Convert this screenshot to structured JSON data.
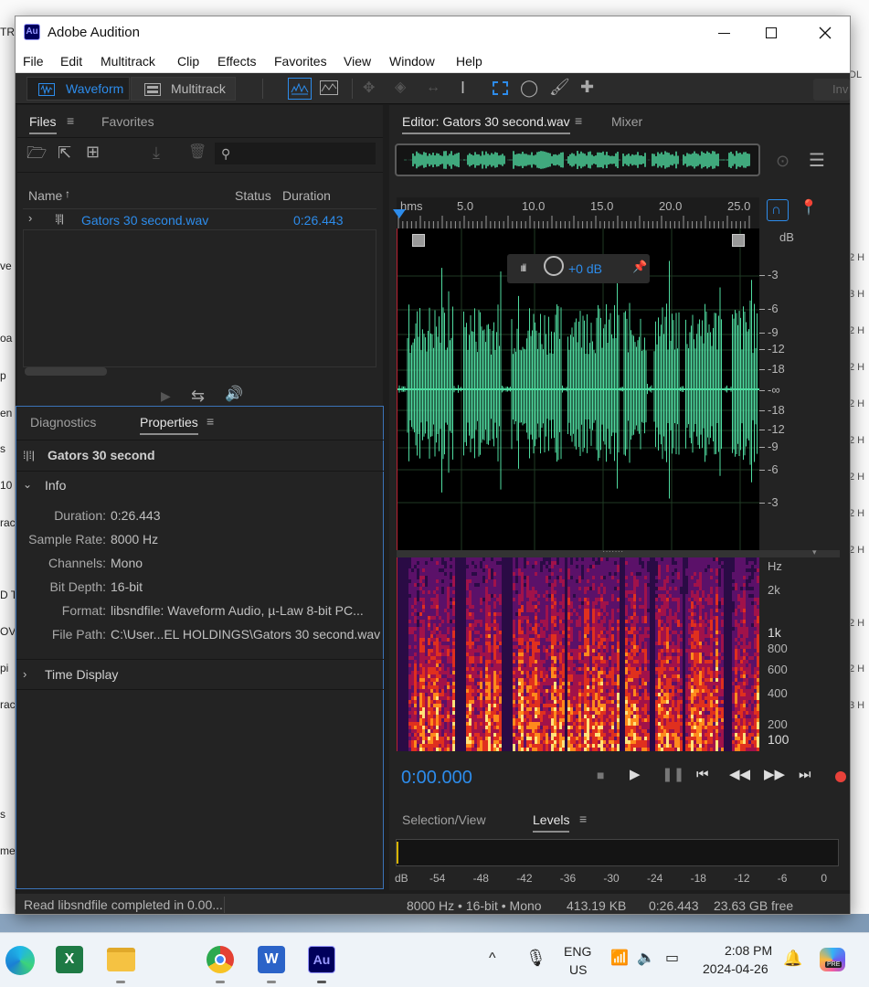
{
  "app": {
    "title": "Adobe Audition",
    "logo_text": "Au"
  },
  "menu": [
    "File",
    "Edit",
    "Multitrack",
    "Clip",
    "Effects",
    "Favorites",
    "View",
    "Window",
    "Help"
  ],
  "toolbar": {
    "waveform_label": "Waveform",
    "multitrack_label": "Multitrack",
    "right_btn": "Inv"
  },
  "files_panel": {
    "tab_files": "Files",
    "tab_favorites": "Favorites",
    "col_name": "Name",
    "col_status": "Status",
    "col_duration": "Duration",
    "file_name": "Gators 30 second.wav",
    "file_duration": "0:26.443"
  },
  "properties": {
    "tab_diagnostics": "Diagnostics",
    "tab_properties": "Properties",
    "title": "Gators 30 second",
    "info_label": "Info",
    "rows": [
      {
        "key": "Duration:",
        "value": "0:26.443"
      },
      {
        "key": "Sample Rate:",
        "value": "8000 Hz"
      },
      {
        "key": "Channels:",
        "value": "Mono"
      },
      {
        "key": "Bit Depth:",
        "value": "16-bit"
      },
      {
        "key": "Format:",
        "value": "libsndfile: Waveform Audio, µ-Law 8-bit PC..."
      },
      {
        "key": "File Path:",
        "value": "C:\\User...EL HOLDINGS\\Gators 30 second.wav"
      }
    ],
    "time_display_label": "Time Display"
  },
  "editor": {
    "tab_editor": "Editor: Gators 30 second.wav",
    "tab_mixer": "Mixer",
    "ruler_labels": [
      "hms",
      "5.0",
      "10.0",
      "15.0",
      "20.0",
      "25.0"
    ],
    "db_labels": [
      "dB",
      "-3",
      "-6",
      "-9",
      "-12",
      "-18",
      "-∞",
      "-18",
      "-12",
      "-9",
      "-6",
      "-3"
    ],
    "hz_labels": [
      "Hz",
      "2k",
      "1k",
      "800",
      "600",
      "400",
      "200",
      "100"
    ],
    "hud_gain": "+0 dB",
    "time_display": "0:00.000"
  },
  "levels_panel": {
    "tab_selection": "Selection/View",
    "tab_levels": "Levels",
    "scale": [
      "dB",
      "-54",
      "-48",
      "-42",
      "-36",
      "-30",
      "-24",
      "-18",
      "-12",
      "-6",
      "0"
    ]
  },
  "status_bar": {
    "message": "Read libsndfile completed in 0.00...",
    "format": "8000 Hz • 16-bit • Mono",
    "size": "413.19 KB",
    "duration": "0:26.443",
    "free": "23.63 GB free"
  },
  "taskbar": {
    "lang_top": "ENG",
    "lang_bottom": "US",
    "time": "2:08 PM",
    "date": "2024-04-26",
    "copilot_badge": "PRE"
  },
  "background_fragments": {
    "left": [
      "TR",
      "ve",
      "oa",
      "p",
      "en",
      "s",
      "10",
      "rac",
      "D T",
      "OV",
      "pi",
      "rac",
      "s",
      "me",
      "%"
    ],
    "right": [
      "DL",
      "2 H",
      "3 H",
      "2 H",
      "2 H",
      "2 H",
      "2 H",
      "2 H",
      "2 H",
      "2 H",
      "2 H",
      "2 H",
      "3 H"
    ]
  },
  "colors": {
    "accent_blue": "#2d8ceb",
    "waveform_green": "#4fdba0",
    "record_red": "#e8413a"
  }
}
